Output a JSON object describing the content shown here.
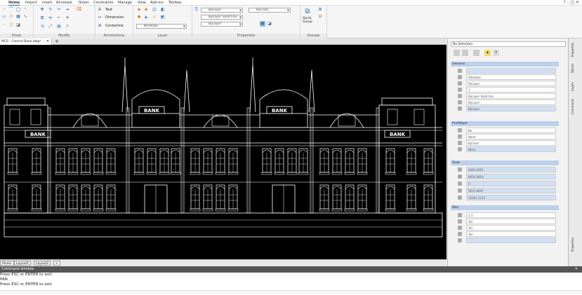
{
  "ribbon_tabs": [
    "Home",
    "Import",
    "Insert",
    "Annotate",
    "Sheet",
    "Constraints",
    "Manage",
    "View",
    "Add-ins",
    "Toolbox"
  ],
  "window_controls": "? – □ ✕",
  "panels": {
    "draw": "Draw",
    "modify": "Modify",
    "annotations": "Annotations",
    "layer": "Layer",
    "properties": "Properties",
    "groups": "Groups"
  },
  "annotations": {
    "text": "Text",
    "dimension": "Dimension",
    "centerline": "Centerline"
  },
  "layer": {
    "windows": "Windows"
  },
  "properties": {
    "color1": "ByLayer",
    "color2": "ByColor",
    "linetype": "ByLayer",
    "solid": "Solid line",
    "lineweight": "ByLayer"
  },
  "groups": {
    "quick_group": "Quick Group"
  },
  "document_tab": "MCS - Central Bank.dwg*",
  "layout_tabs": [
    "Model",
    "Layout1",
    "Layout2"
  ],
  "props_panel": {
    "selection": "No Selection",
    "general": "General",
    "general_rows": [
      "",
      "Windows",
      "ByLayer",
      "1",
      "ByLayer     Solid line",
      "ByLayer",
      "ByLayer"
    ],
    "printstyle": "PrintStyle",
    "printstyle_rows": [
      "No",
      "None",
      "ByColor",
      "None"
    ],
    "view": "View",
    "view_rows": [
      "8362.6301",
      "6924.6819",
      "0",
      "5631.8497",
      "10461.2314"
    ],
    "misc": "Misc",
    "misc_rows": [
      "1:1",
      "Yes",
      "Yes",
      "Yes",
      ""
    ]
  },
  "side_tabs": [
    "Properties",
    "Blocks",
    "Layers",
    "Commands",
    "Properties"
  ],
  "command": {
    "title": "Command window",
    "lines": [
      "Press ESC or ENTER to exit.",
      "PAN",
      "Press ESC or ENTER to exit"
    ]
  },
  "colors": {
    "canvas": "#000000",
    "accent": "#2b6cb0",
    "section": "#bcd0ea"
  }
}
